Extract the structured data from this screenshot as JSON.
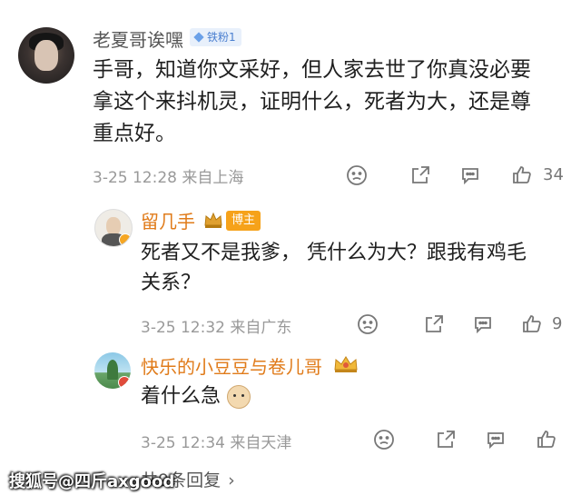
{
  "main_comment": {
    "username": "老夏哥诶嘿",
    "fan_badge": "铁粉1",
    "text_lines": [
      "手哥，知道你文采好，但人家去世了你真没必要",
      "拿这个来抖机灵，证明什么，死者为大，还是尊",
      "重点好。"
    ],
    "meta": "3-25 12:28 来自上海",
    "like_count": "34"
  },
  "replies": [
    {
      "username": "留几手",
      "tag": "博主",
      "text_lines": [
        "死者又不是我爹， 凭什么为大？跟我有鸡毛",
        "关系？"
      ],
      "meta": "3-25 12:32 来自广东",
      "like_count": "9"
    },
    {
      "username": "快乐的小豆豆与卷儿哥",
      "text_lines": [
        "着什么急"
      ],
      "meta": "3-25 12:34 来自天津",
      "like_count": ""
    }
  ],
  "more_replies": "共9条回复",
  "more_replies_chevron": "›",
  "watermark": "搜狐号@四斤axgood",
  "icons": {
    "dislike": "frown-icon",
    "share": "share-icon",
    "comment": "comment-icon",
    "like": "thumbs-up-icon"
  },
  "colors": {
    "reply_username": "#e07b1a",
    "boss_tag": "#f6a21a",
    "fan_badge": "#4a7fd0"
  }
}
